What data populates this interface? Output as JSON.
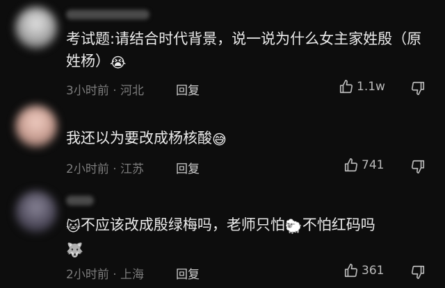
{
  "comments": [
    {
      "text": "考试题:请结合时代背景，说一说为什么女主家姓殷（原姓杨）",
      "emoji": "😭",
      "time": "3小时前",
      "location": "河北",
      "reply": "回复",
      "likes": "1.1w"
    },
    {
      "text": "我还以为要改成杨核酸",
      "emoji": "😅",
      "time": "2小时前",
      "location": "江苏",
      "reply": "回复",
      "likes": "741"
    },
    {
      "text_a": "不应该改成殷绿梅吗，老师只怕",
      "emoji_a": "🐱",
      "emoji_b": "🐑",
      "text_b": "不怕红码吗",
      "emoji_c": "🐺",
      "time": "2小时前",
      "location": "上海",
      "reply": "回复",
      "likes": "361"
    }
  ],
  "separator": "·",
  "icons": [
    "thumb-up-icon",
    "thumb-down-icon"
  ]
}
